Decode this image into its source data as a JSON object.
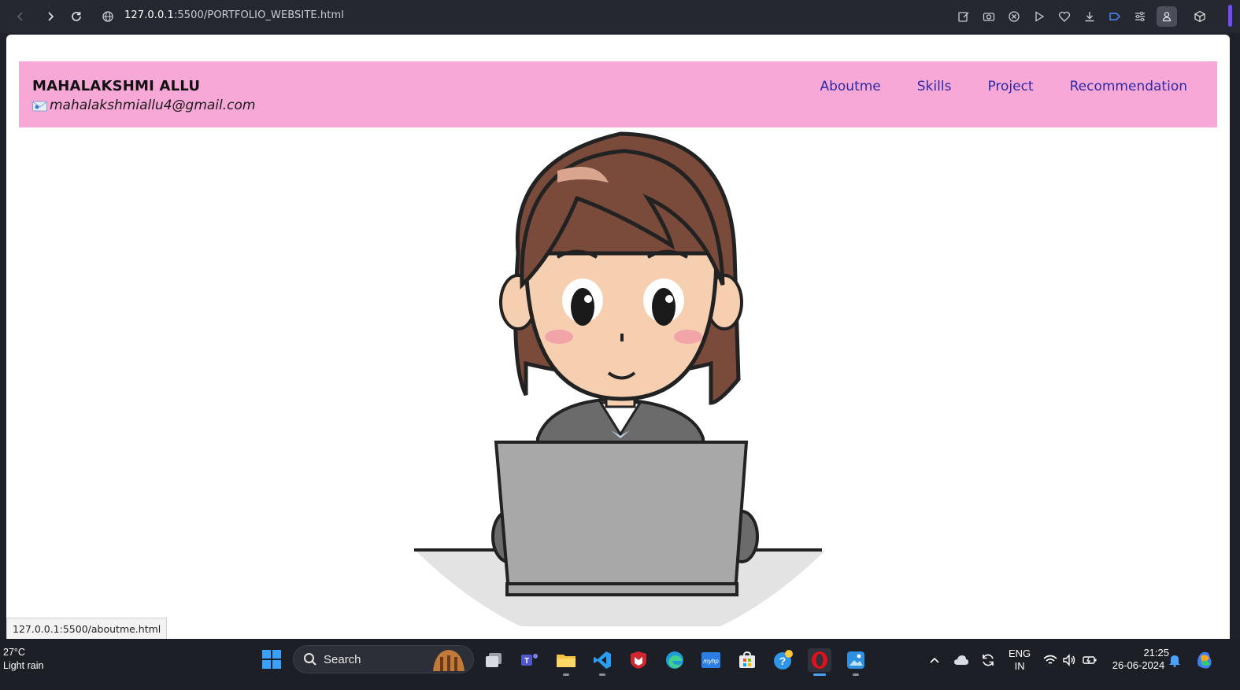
{
  "browser": {
    "url_host": "127.0.0.1",
    "url_path": ":5500/PORTFOLIO_WEBSITE.html"
  },
  "site": {
    "name": "MAHALAKSHMI ALLU",
    "email": "mahalakshmiallu4@gmail.com",
    "nav": [
      "Aboutme",
      "Skills",
      "Project",
      "Recommendation"
    ]
  },
  "status_bar": {
    "hover_url": "127.0.0.1:5500/aboutme.html"
  },
  "taskbar": {
    "weather_temp": "27°C",
    "weather_desc": "Light rain",
    "search_label": "Search",
    "lang_top": "ENG",
    "lang_bottom": "IN",
    "time": "21:25",
    "date": "26-06-2024"
  },
  "colors": {
    "header_pink": "#f8a8d6",
    "nav_link": "#2d2aa6",
    "browser_accent": "#6f4cf6"
  }
}
